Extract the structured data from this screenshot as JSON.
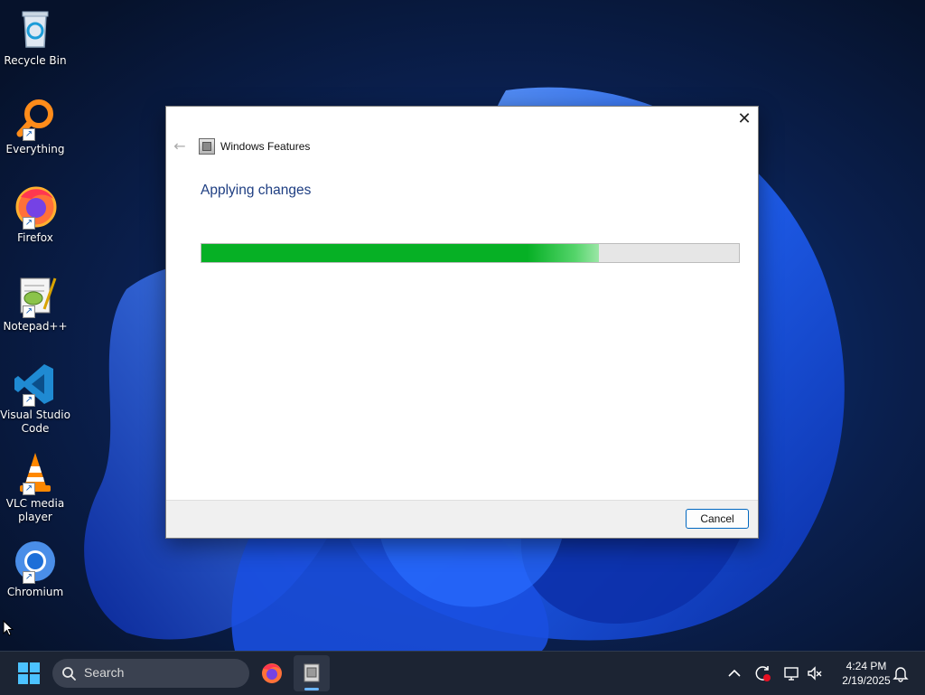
{
  "desktop": {
    "icons": [
      {
        "label": "Recycle Bin"
      },
      {
        "label": "Everything"
      },
      {
        "label": "Firefox"
      },
      {
        "label": "Notepad++"
      },
      {
        "label": "Visual Studio Code"
      },
      {
        "label": "VLC media player"
      },
      {
        "label": "Chromium"
      }
    ]
  },
  "dialog": {
    "title": "Windows Features",
    "heading": "Applying changes",
    "progress_percent": 74,
    "cancel_label": "Cancel",
    "close_glyph": "✕",
    "back_glyph": "←"
  },
  "taskbar": {
    "search_placeholder": "Search",
    "time": "4:24 PM",
    "date": "2/19/2025",
    "apps": [
      "firefox-icon",
      "windows-features-icon"
    ],
    "tray": [
      "chevron-up-icon",
      "update-icon",
      "network-icon",
      "volume-muted-icon",
      "notification-icon"
    ]
  },
  "colors": {
    "accent": "#0067c0",
    "progress_green": "#06b025",
    "heading_blue": "#1e3e82",
    "taskbar_bg": "#1c2433"
  }
}
